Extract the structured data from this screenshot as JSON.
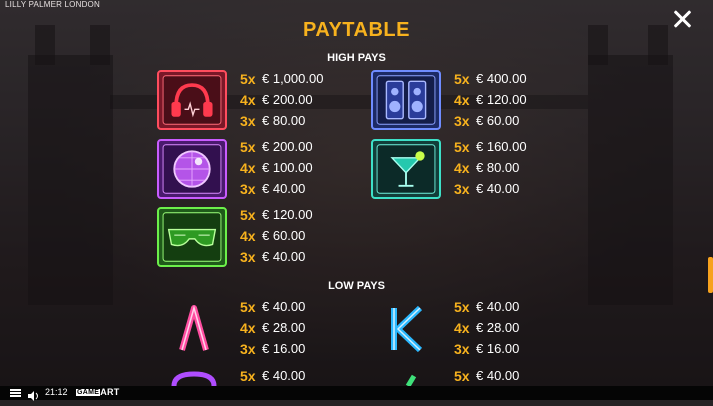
{
  "header": {
    "game_title": "LILLY PALMER LONDON",
    "close_icon": "close-icon"
  },
  "paytable": {
    "title": "PAYTABLE",
    "high_pays_label": "HIGH PAYS",
    "low_pays_label": "LOW PAYS",
    "high_pays": [
      {
        "symbol": "headphones-icon",
        "pays": [
          {
            "mult": "5x",
            "amount": "€ 1,000.00"
          },
          {
            "mult": "4x",
            "amount": "€ 200.00"
          },
          {
            "mult": "3x",
            "amount": "€ 80.00"
          }
        ]
      },
      {
        "symbol": "speakers-icon",
        "pays": [
          {
            "mult": "5x",
            "amount": "€ 400.00"
          },
          {
            "mult": "4x",
            "amount": "€ 120.00"
          },
          {
            "mult": "3x",
            "amount": "€ 60.00"
          }
        ]
      },
      {
        "symbol": "disco-ball-icon",
        "pays": [
          {
            "mult": "5x",
            "amount": "€ 200.00"
          },
          {
            "mult": "4x",
            "amount": "€ 100.00"
          },
          {
            "mult": "3x",
            "amount": "€ 40.00"
          }
        ]
      },
      {
        "symbol": "cocktail-icon",
        "pays": [
          {
            "mult": "5x",
            "amount": "€ 160.00"
          },
          {
            "mult": "4x",
            "amount": "€ 80.00"
          },
          {
            "mult": "3x",
            "amount": "€ 40.00"
          }
        ]
      },
      {
        "symbol": "sunglasses-icon",
        "pays": [
          {
            "mult": "5x",
            "amount": "€ 120.00"
          },
          {
            "mult": "4x",
            "amount": "€ 60.00"
          },
          {
            "mult": "3x",
            "amount": "€ 40.00"
          }
        ]
      }
    ],
    "low_pays": [
      {
        "symbol": "letter-a-icon",
        "pays": [
          {
            "mult": "5x",
            "amount": "€ 40.00"
          },
          {
            "mult": "4x",
            "amount": "€ 28.00"
          },
          {
            "mult": "3x",
            "amount": "€ 16.00"
          }
        ]
      },
      {
        "symbol": "letter-k-icon",
        "pays": [
          {
            "mult": "5x",
            "amount": "€ 40.00"
          },
          {
            "mult": "4x",
            "amount": "€ 28.00"
          },
          {
            "mult": "3x",
            "amount": "€ 16.00"
          }
        ]
      },
      {
        "symbol": "letter-q-icon",
        "pays": [
          {
            "mult": "5x",
            "amount": "€ 40.00"
          }
        ]
      },
      {
        "symbol": "letter-j-icon",
        "pays": [
          {
            "mult": "5x",
            "amount": "€ 40.00"
          }
        ]
      }
    ]
  },
  "bottom_bar": {
    "time": "21:12",
    "brand_prefix": "GAME",
    "brand_suffix": "ART"
  },
  "colors": {
    "accent": "#f7b21e",
    "text": "#ffffff",
    "bar": "#050505"
  }
}
